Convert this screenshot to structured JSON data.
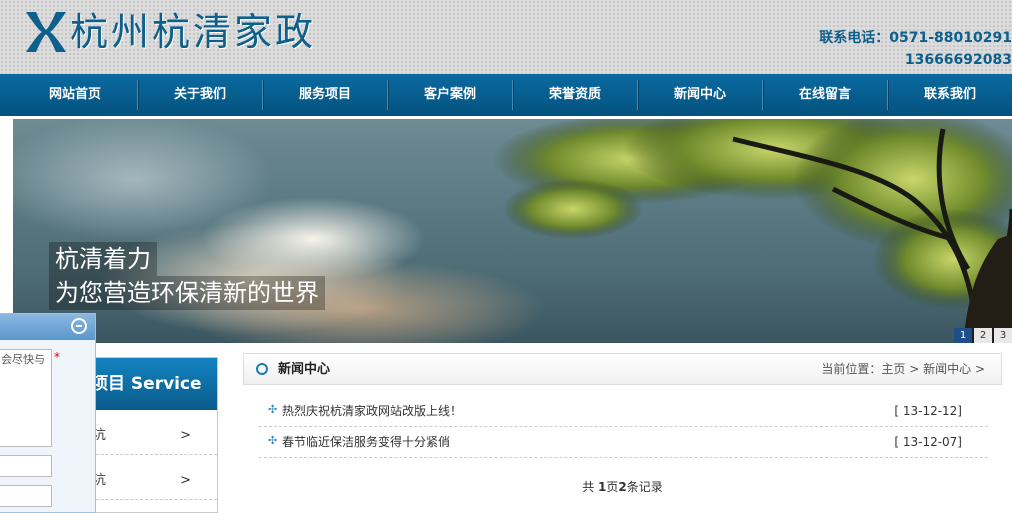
{
  "header": {
    "logo_text": "杭州杭清家政",
    "phone_line1": "联系电话：0571-88010291",
    "phone_line2": "13666692083"
  },
  "nav": {
    "items": [
      "网站首页",
      "关于我们",
      "服务项目",
      "客户案例",
      "荣誉资质",
      "新闻中心",
      "在线留言",
      "联系我们"
    ]
  },
  "banner": {
    "slogan_line1": "杭清着力",
    "slogan_line2": "为您营造环保清新的世界",
    "slides": [
      "1",
      "2",
      "3"
    ],
    "active_slide": 1
  },
  "message_widget": {
    "textarea_text": "会尽快与",
    "required_mark": "*"
  },
  "sidebar": {
    "title": "项目 Service",
    "items": [
      {
        "label": "沆",
        "arrow": ">"
      },
      {
        "label": "沆",
        "arrow": ">"
      }
    ]
  },
  "news": {
    "section_title": "新闻中心",
    "breadcrumb_prefix": "当前位置：",
    "breadcrumb_home": "主页",
    "breadcrumb_sep": ">",
    "breadcrumb_current": "新闻中心",
    "items": [
      {
        "title": "热烈庆祝杭清家政网站改版上线！",
        "date": "[ 13-12-12]"
      },
      {
        "title": "春节临近保洁服务变得十分紧俏",
        "date": "[ 13-12-07]"
      }
    ],
    "pager": {
      "prefix": "共 ",
      "pages": "1",
      "middle": "页",
      "count": "2",
      "suffix": "条记录"
    }
  },
  "colors": {
    "brand_blue": "#0d5f8c",
    "nav_blue": "#04527e",
    "accent_blue": "#1d7ab3"
  }
}
